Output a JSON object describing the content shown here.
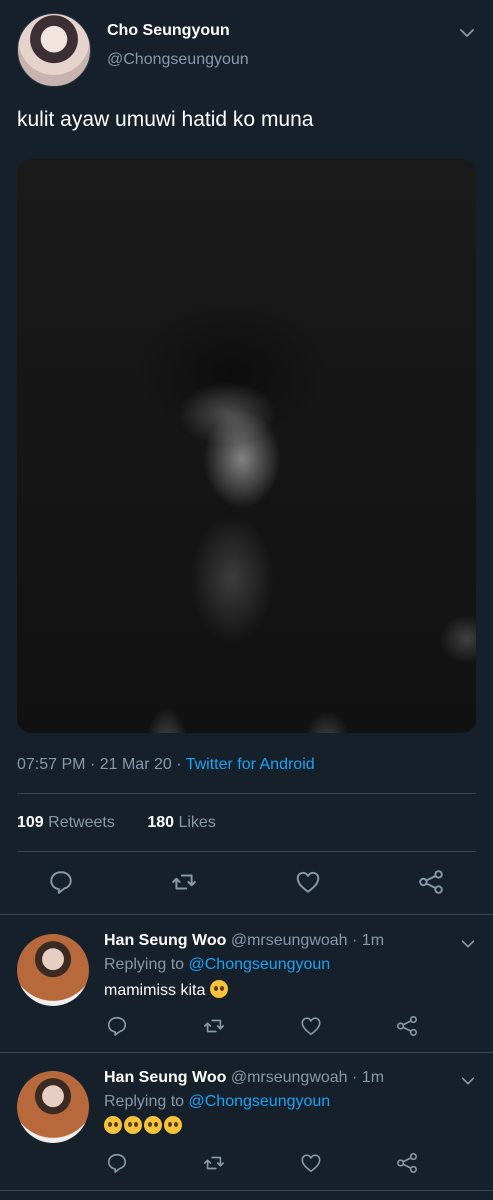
{
  "main_tweet": {
    "author_name": "Cho Seungyoun",
    "author_handle": "@Chongseungyoun",
    "text": "kulit ayaw umuwi hatid ko muna",
    "time": "07:57 PM",
    "date": "21 Mar 20",
    "source": "Twitter for Android",
    "retweets_count": "109",
    "retweets_label": "Retweets",
    "likes_count": "180",
    "likes_label": "Likes"
  },
  "replies": [
    {
      "author_name": "Han Seung Woo",
      "author_handle": "@mrseungwoah",
      "time": "1m",
      "replying_label": "Replying to",
      "replying_to": "@Chongseungyoun",
      "text": "mamimiss kita",
      "emoji_count": 1
    },
    {
      "author_name": "Han Seung Woo",
      "author_handle": "@mrseungwoah",
      "time": "1m",
      "replying_label": "Replying to",
      "replying_to": "@Chongseungyoun",
      "text": "",
      "emoji_count": 4
    }
  ],
  "colors": {
    "background": "#15202b",
    "text_primary": "#ffffff",
    "text_secondary": "#8899a6",
    "accent": "#1da1f2",
    "divider": "#38444d"
  },
  "icons": [
    "chevron-down-icon",
    "reply-icon",
    "retweet-icon",
    "like-icon",
    "share-icon",
    "pleading-face-emoji"
  ]
}
